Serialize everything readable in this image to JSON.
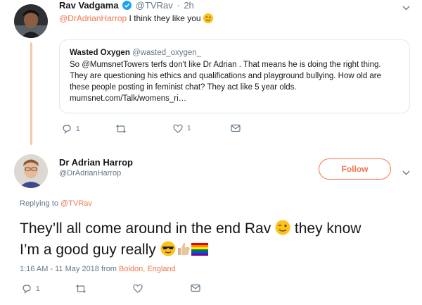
{
  "colors": {
    "accent": "#f4764d",
    "verified": "#1da1f2",
    "muted": "#657786",
    "thread": "#f7c8a6"
  },
  "tweet1": {
    "name": "Rav Vadgama",
    "handle": "@TVRav",
    "separator": "·",
    "time": "2h",
    "mention": "@DrAdrianHarrop",
    "text": " I think they like you",
    "emoji_icon": "winking-face-emoji"
  },
  "quote": {
    "name": "Wasted Oxygen",
    "handle": "@wasted_oxygen_",
    "line1": "So @MumsnetTowers terfs don't like Dr Adrian . That means he is doing the right thing.",
    "line2": "They are questioning his ethics and qualifications and playground bullying. How old are",
    "line3": "these people posting in feminist chat? They act like 5 year olds.",
    "line4": "mumsnet.com/Talk/womens_ri…"
  },
  "tweet1_actions": {
    "reply_count": "1",
    "retweet_count": "",
    "like_count": "1"
  },
  "tweet2": {
    "name": "Dr Adrian Harrop",
    "handle": "@DrAdrianHarrop",
    "follow_label": "Follow",
    "replying_prefix": "Replying to ",
    "replying_to": "@TVRav",
    "text_part1": "They’ll all come around in the end Rav",
    "text_part2": " they know",
    "text_part3": "I’m a good guy really",
    "emojis": [
      "winking-face-emoji",
      "sunglasses-face-emoji",
      "thumbs-up-emoji",
      "rainbow-flag-emoji"
    ],
    "timestamp": "1:16 AM - 11 May 2018 from ",
    "location": "Boldon, England"
  },
  "tweet2_actions": {
    "reply_count": "1",
    "retweet_count": "",
    "like_count": ""
  }
}
